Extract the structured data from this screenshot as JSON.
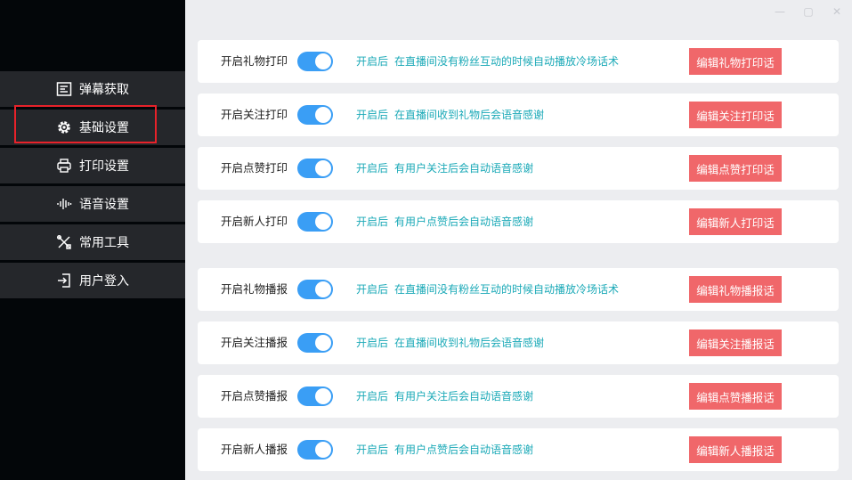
{
  "window_controls": {
    "minimize": "—",
    "maximize": "▢",
    "close": "✕"
  },
  "sidebar": {
    "items": [
      {
        "label": "弹幕获取",
        "icon": "barrage-list-icon"
      },
      {
        "label": "基础设置",
        "icon": "gear-icon",
        "active": true
      },
      {
        "label": "打印设置",
        "icon": "printer-icon"
      },
      {
        "label": "语音设置",
        "icon": "waveform-icon"
      },
      {
        "label": "常用工具",
        "icon": "tools-icon"
      },
      {
        "label": "用户登入",
        "icon": "login-icon"
      }
    ]
  },
  "settings": [
    {
      "label": "开启礼物打印",
      "enabled": true,
      "desc_prefix": "开启后",
      "desc": "在直播间没有粉丝互动的时候自动播放冷场话术",
      "button": "编辑礼物打印话"
    },
    {
      "label": "开启关注打印",
      "enabled": true,
      "desc_prefix": "开启后",
      "desc": "在直播间收到礼物后会语音感谢",
      "button": "编辑关注打印话"
    },
    {
      "label": "开启点赞打印",
      "enabled": true,
      "desc_prefix": "开启后",
      "desc": "有用户关注后会自动语音感谢",
      "button": "编辑点赞打印话"
    },
    {
      "label": "开启新人打印",
      "enabled": true,
      "desc_prefix": "开启后",
      "desc": "有用户点赞后会自动语音感谢",
      "button": "编辑新人打印话"
    },
    {
      "label": "开启礼物播报",
      "enabled": true,
      "desc_prefix": "开启后",
      "desc": "在直播间没有粉丝互动的时候自动播放冷场话术",
      "button": "编辑礼物播报话"
    },
    {
      "label": "开启关注播报",
      "enabled": true,
      "desc_prefix": "开启后",
      "desc": "在直播间收到礼物后会语音感谢",
      "button": "编辑关注播报话"
    },
    {
      "label": "开启点赞播报",
      "enabled": true,
      "desc_prefix": "开启后",
      "desc": "有用户关注后会自动语音感谢",
      "button": "编辑点赞播报话"
    },
    {
      "label": "开启新人播报",
      "enabled": true,
      "desc_prefix": "开启后",
      "desc": "有用户点赞后会自动语音感谢",
      "button": "编辑新人播报话"
    }
  ],
  "colors": {
    "toggle_on": "#3a9ef5",
    "button": "#f0676a",
    "description": "#1aa9b7",
    "active_frame": "#e8222a"
  }
}
